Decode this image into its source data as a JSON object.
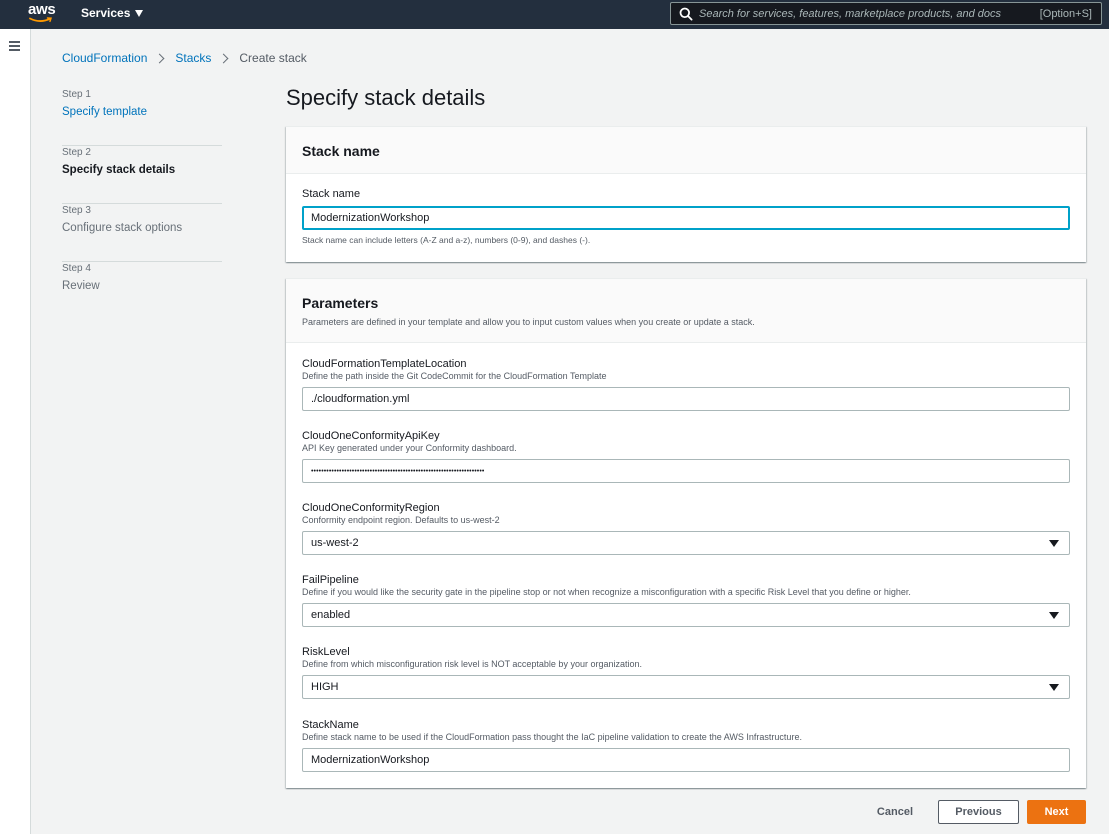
{
  "nav": {
    "logo_text": "aws",
    "services_label": "Services",
    "search_placeholder": "Search for services, features, marketplace products, and docs",
    "search_shortcut": "[Option+S]"
  },
  "breadcrumb": {
    "items": [
      "CloudFormation",
      "Stacks"
    ],
    "current": "Create stack"
  },
  "steps": [
    {
      "num": "Step 1",
      "label": "Specify template"
    },
    {
      "num": "Step 2",
      "label": "Specify stack details"
    },
    {
      "num": "Step 3",
      "label": "Configure stack options"
    },
    {
      "num": "Step 4",
      "label": "Review"
    }
  ],
  "page_title": "Specify stack details",
  "stack_name_panel": {
    "title": "Stack name",
    "field_label": "Stack name",
    "value": "ModernizationWorkshop",
    "constraint": "Stack name can include letters (A-Z and a-z), numbers (0-9), and dashes (-)."
  },
  "parameters_panel": {
    "title": "Parameters",
    "description": "Parameters are defined in your template and allow you to input custom values when you create or update a stack.",
    "fields": [
      {
        "label": "CloudFormationTemplateLocation",
        "desc": "Define the path inside the Git CodeCommit for the CloudFormation Template",
        "value": "./cloudformation.yml"
      },
      {
        "label": "CloudOneConformityApiKey",
        "desc": "API Key generated under your Conformity dashboard.",
        "value": "••••••••••••••••••••••••••••••••••••••••••••••••••••••••••••••••••••"
      },
      {
        "label": "CloudOneConformityRegion",
        "desc": "Conformity endpoint region. Defaults to us-west-2",
        "value": "us-west-2"
      },
      {
        "label": "FailPipeline",
        "desc": "Define if you would like the security gate in the pipeline stop or not when recognize a misconfiguration with a specific Risk Level that you define or higher.",
        "value": "enabled"
      },
      {
        "label": "RiskLevel",
        "desc": "Define from which misconfiguration risk level is NOT acceptable by your organization.",
        "value": "HIGH"
      },
      {
        "label": "StackName",
        "desc": "Define stack name to be used if the CloudFormation pass thought the IaC pipeline validation to create the AWS Infrastructure.",
        "value": "ModernizationWorkshop"
      }
    ]
  },
  "buttons": {
    "cancel": "Cancel",
    "previous": "Previous",
    "next": "Next"
  },
  "colors": {
    "nav_bg": "#232f3e",
    "link": "#0073bb",
    "primary_button": "#ec7211",
    "focus": "#00a1c9",
    "logo_smile": "#ff9900"
  }
}
